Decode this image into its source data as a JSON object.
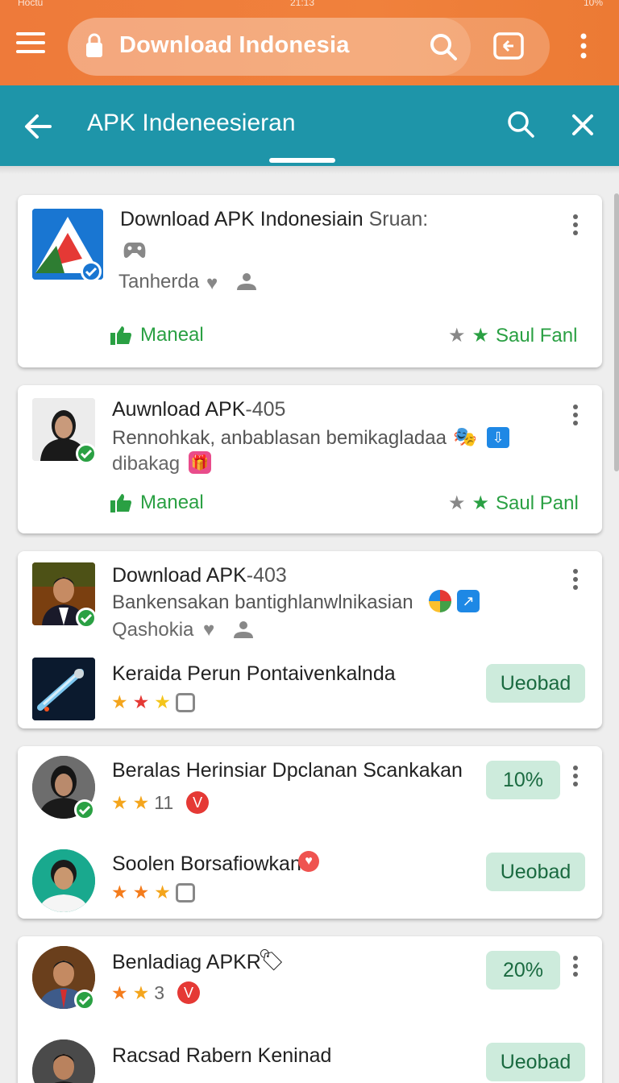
{
  "status": {
    "left": "Hoctu",
    "center": "21:13",
    "right": "10%"
  },
  "browser": {
    "url_text": "Download Indonesia"
  },
  "subheader": {
    "title": "APK Indeneesieran"
  },
  "colors": {
    "orange": "#ef7b3a",
    "teal": "#1e95a9",
    "green": "#2aa043",
    "pill": "#cdebdc"
  },
  "cards": [
    {
      "title": "Download APK Indonesiain",
      "title_suffix": "Sruan:",
      "meta": "Tanherda",
      "action": "Maneal",
      "rating_label": "Saul Fanl"
    },
    {
      "title": "Auwnload APK",
      "title_suffix": "-405",
      "desc": "Rennohkak, anbablasan bemikagladaa",
      "meta": "dibakag",
      "action": "Maneal",
      "rating_label": "Saul Panl"
    },
    {
      "title": "Download APK",
      "title_suffix": "-403",
      "desc": "Bankensakan bantighlanwlnikasian",
      "meta": "Qashokia",
      "sub_title": "Keraida Perun Pontaivenkalnda",
      "sub_button": "Ueobad"
    },
    {
      "row1_title": "Beralas Herinsiar Dpclanan Scankakan",
      "row1_count": "11",
      "row1_badge": "10%",
      "row2_title": "Soolen Borsafiowkan",
      "row2_button": "Ueobad"
    },
    {
      "row1_title": "Benladiag APKR",
      "row1_count": "3",
      "row1_badge": "20%",
      "row2_title": "Racsad Rabern Keninad",
      "row2_button": "Ueobad"
    }
  ]
}
